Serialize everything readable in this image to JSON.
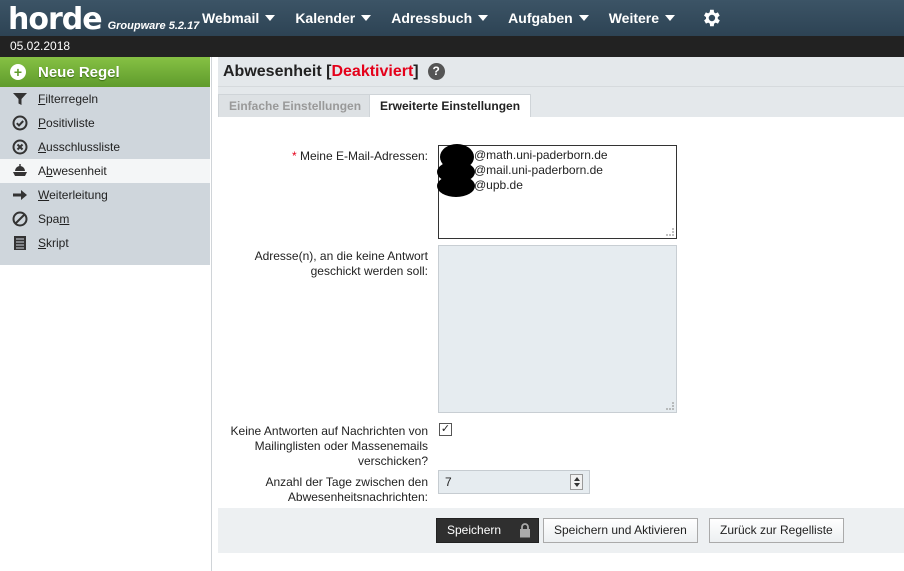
{
  "app": {
    "logo": "horde",
    "version": "Groupware 5.2.17"
  },
  "menu": [
    {
      "label": "Webmail"
    },
    {
      "label": "Kalender"
    },
    {
      "label": "Adressbuch"
    },
    {
      "label": "Aufgaben"
    },
    {
      "label": "Weitere"
    }
  ],
  "date": "05.02.2018",
  "sidebar": {
    "new_rule": "Neue Regel",
    "items": [
      {
        "label": "Filterregeln",
        "underline": "F",
        "rest": "ilterregeln",
        "icon": "funnel-icon"
      },
      {
        "label": "Positivliste",
        "underline": "P",
        "rest": "ositivliste",
        "icon": "check-circle-icon"
      },
      {
        "label": "Ausschlussliste",
        "underline": "A",
        "rest": "usschlussliste",
        "icon": "x-circle-icon"
      },
      {
        "label": "Abwesenheit",
        "underline": "b",
        "pre": "A",
        "rest": "wesenheit",
        "icon": "vacation-icon",
        "active": true
      },
      {
        "label": "Weiterleitung",
        "underline": "W",
        "rest": "eiterleitung",
        "icon": "arrow-right-icon"
      },
      {
        "label": "Spam",
        "underline": "m",
        "pre": "Spa",
        "rest": "",
        "icon": "ban-icon"
      },
      {
        "label": "Skript",
        "underline": "S",
        "rest": "kript",
        "icon": "script-icon"
      }
    ]
  },
  "page": {
    "title_prefix": "Abwesenheit [",
    "status": "Deaktiviert",
    "title_suffix": "]",
    "help": "?"
  },
  "tabs": {
    "simple": "Einfache Einstellungen",
    "advanced": "Erweiterte Einstellungen"
  },
  "form": {
    "required_mark": "*",
    "addresses_label": "Meine E-Mail-Adressen:",
    "addresses": [
      "@math.uni-paderborn.de",
      "@mail.uni-paderborn.de",
      "@upb.de"
    ],
    "noreply_label_1": "Adresse(n), an die keine Antwort",
    "noreply_label_2": "geschickt werden soll:",
    "mailinglist_label_1": "Keine Antworten auf Nachrichten von",
    "mailinglist_label_2": "Mailinglisten oder Massenemails",
    "mailinglist_label_3": "verschicken?",
    "mailinglist_checked": true,
    "days_label_1": "Anzahl der Tage zwischen den",
    "days_label_2": "Abwesenheitsnachrichten:",
    "days_value": "7"
  },
  "buttons": {
    "save": "Speichern",
    "save_activate": "Speichern und Aktivieren",
    "back": "Zurück zur Regelliste"
  }
}
